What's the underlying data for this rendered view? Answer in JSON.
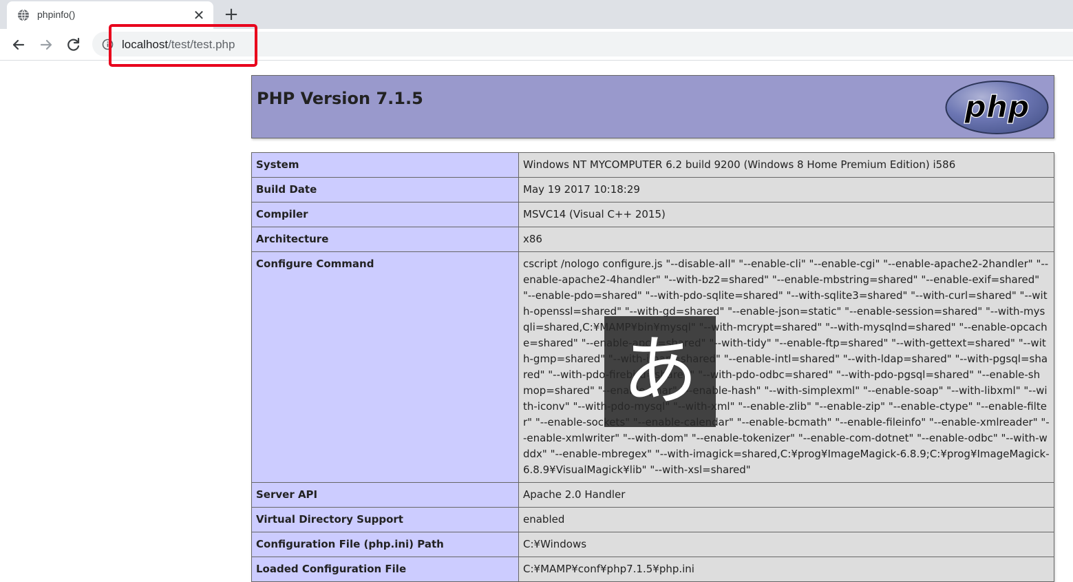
{
  "browser": {
    "tab": {
      "title": "phpinfo()",
      "close_glyph": "✕",
      "favicon": "globe-icon"
    },
    "new_tab_glyph": "+",
    "address": {
      "host": "localhost",
      "path": "/test/test.php"
    },
    "highlight_color": "#e8001c"
  },
  "page": {
    "title": "PHP Version 7.1.5",
    "logo_text": "php",
    "rows": [
      {
        "key": "System",
        "value": "Windows NT MYCOMPUTER 6.2 build 9200 (Windows 8 Home Premium Edition) i586"
      },
      {
        "key": "Build Date",
        "value": "May 19 2017 10:18:29"
      },
      {
        "key": "Compiler",
        "value": "MSVC14 (Visual C++ 2015)"
      },
      {
        "key": "Architecture",
        "value": "x86"
      },
      {
        "key": "Configure Command",
        "value": "cscript /nologo configure.js \"--disable-all\" \"--enable-cli\" \"--enable-cgi\" \"--enable-apache2-2handler\" \"--enable-apache2-4handler\" \"--with-bz2=shared\" \"--enable-mbstring=shared\" \"--enable-exif=shared\" \"--enable-pdo=shared\" \"--with-pdo-sqlite=shared\" \"--with-sqlite3=shared\" \"--with-curl=shared\" \"--with-openssl=shared\" \"--with-gd=shared\" \"--enable-json=static\" \"--enable-session=shared\" \"--with-mysqli=shared,C:¥MAMP¥bin¥mysql\" \"--with-mcrypt=shared\" \"--with-mysqlnd=shared\" \"--enable-opcache=shared\" \"--enable-apcu=shared\" \"--with-tidy\" \"--enable-ftp=shared\" \"--with-gettext=shared\" \"--with-gmp=shared\" \"--with-imap=shared\" \"--enable-intl=shared\" \"--with-ldap=shared\" \"--with-pgsql=shared\" \"--with-pdo-firebird=shared\" \"--with-pdo-odbc=shared\" \"--with-pdo-pgsql=shared\" \"--enable-shmop=shared\" \"--enable-phar\" \"--enable-hash\" \"--with-simplexml\" \"--enable-soap\" \"--with-libxml\" \"--with-iconv\" \"--with-pdo-mysql\" \"--with-xml\" \"--enable-zlib\" \"--enable-zip\" \"--enable-ctype\" \"--enable-filter\" \"--enable-sockets\" \"--enable-calendar\" \"--enable-bcmath\" \"--enable-fileinfo\" \"--enable-xmlreader\" \"--enable-xmlwriter\" \"--with-dom\" \"--enable-tokenizer\" \"--enable-com-dotnet\" \"--enable-odbc\" \"--with-wddx\" \"--enable-mbregex\" \"--with-imagick=shared,C:¥prog¥ImageMagick-6.8.9;C:¥prog¥ImageMagick-6.8.9¥VisualMagick¥lib\" \"--with-xsl=shared\""
      },
      {
        "key": "Server API",
        "value": "Apache 2.0 Handler"
      },
      {
        "key": "Virtual Directory Support",
        "value": "enabled"
      },
      {
        "key": "Configuration File (php.ini) Path",
        "value": "C:¥Windows"
      },
      {
        "key": "Loaded Configuration File",
        "value": "C:¥MAMP¥conf¥php7.1.5¥php.ini"
      }
    ]
  },
  "ime_indicator": "あ",
  "colors": {
    "header_bg": "#9999cc",
    "key_bg": "#ccccff",
    "value_bg": "#dddddd"
  }
}
